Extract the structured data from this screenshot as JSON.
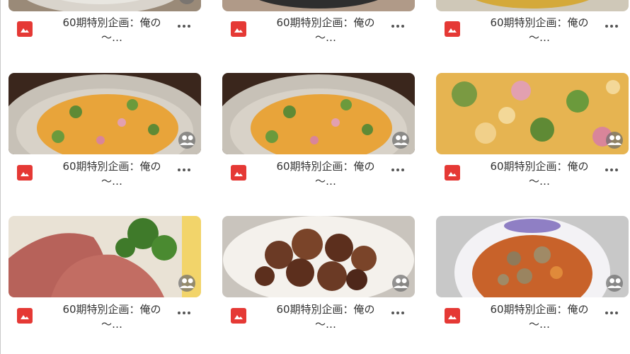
{
  "grid": {
    "items": [
      {
        "title_line1": "60期特別企画：俺の",
        "title_line2": "〜…",
        "image": "food-photo",
        "shared_icon": "shared-people-icon",
        "file_icon": "image-file-icon",
        "more_icon": "more-options-icon"
      },
      {
        "title_line1": "60期特別企画：俺の",
        "title_line2": "〜…",
        "image": "food-photo",
        "shared_icon": "shared-people-icon",
        "file_icon": "image-file-icon",
        "more_icon": "more-options-icon"
      },
      {
        "title_line1": "60期特別企画：俺の",
        "title_line2": "〜…",
        "image": "food-photo",
        "shared_icon": "shared-people-icon",
        "file_icon": "image-file-icon",
        "more_icon": "more-options-icon"
      },
      {
        "title_line1": "60期特別企画：俺の",
        "title_line2": "〜…",
        "image": "macaroni-salad-photo",
        "shared_icon": "shared-people-icon",
        "file_icon": "image-file-icon",
        "more_icon": "more-options-icon"
      },
      {
        "title_line1": "60期特別企画：俺の",
        "title_line2": "〜…",
        "image": "macaroni-salad-photo",
        "shared_icon": "shared-people-icon",
        "file_icon": "image-file-icon",
        "more_icon": "more-options-icon"
      },
      {
        "title_line1": "60期特別企画：俺の",
        "title_line2": "〜…",
        "image": "macaroni-salad-closeup-photo",
        "shared_icon": "shared-people-icon",
        "file_icon": "image-file-icon",
        "more_icon": "more-options-icon"
      },
      {
        "title_line1": "60期特別企画：俺の",
        "title_line2": "〜…",
        "image": "roast-beef-photo",
        "shared_icon": "shared-people-icon",
        "file_icon": "image-file-icon",
        "more_icon": "more-options-icon"
      },
      {
        "title_line1": "60期特別企画：俺の",
        "title_line2": "〜…",
        "image": "fried-chicken-photo",
        "shared_icon": "shared-people-icon",
        "file_icon": "image-file-icon",
        "more_icon": "more-options-icon"
      },
      {
        "title_line1": "60期特別企画：俺の",
        "title_line2": "〜…",
        "image": "stew-bowl-photo",
        "shared_icon": "shared-people-icon",
        "file_icon": "image-file-icon",
        "more_icon": "more-options-icon"
      }
    ]
  },
  "colors": {
    "file_icon_red": "#e53935",
    "title_text": "#333333"
  }
}
